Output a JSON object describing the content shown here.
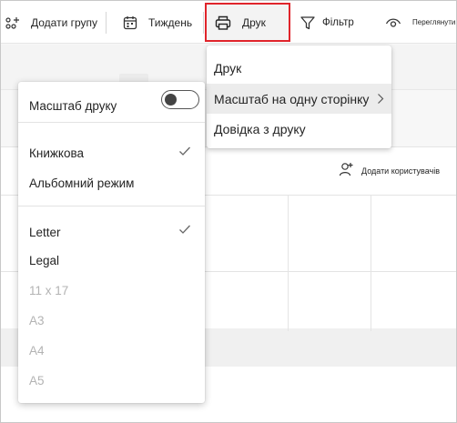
{
  "toolbar": {
    "add_group_label": "Додати групу",
    "week_label": "Тиждень",
    "print_label": "Друк",
    "filter_label": "Фільтр",
    "view_label": "Переглянути",
    "highlight_color": "#e0242b"
  },
  "background": {
    "add_users_label": "Додати користувачів"
  },
  "print_menu": {
    "items": [
      {
        "label": "Друк"
      },
      {
        "label": "Масштаб на одну сторінку",
        "active": true,
        "submenu": true
      },
      {
        "label": "Довідка з друку"
      }
    ]
  },
  "scale_panel": {
    "scale_label": "Масштаб друку",
    "scale_enabled": false,
    "orientation": [
      {
        "label": "Книжкова",
        "checked": true
      },
      {
        "label": "Альбомний режим",
        "checked": false
      }
    ],
    "paper_sizes": [
      {
        "label": "Letter",
        "checked": true,
        "enabled": true
      },
      {
        "label": "Legal",
        "checked": false,
        "enabled": true
      },
      {
        "label": "11 x 17",
        "checked": false,
        "enabled": false
      },
      {
        "label": "A3",
        "checked": false,
        "enabled": false
      },
      {
        "label": "A4",
        "checked": false,
        "enabled": false
      },
      {
        "label": "A5",
        "checked": false,
        "enabled": false
      }
    ]
  }
}
